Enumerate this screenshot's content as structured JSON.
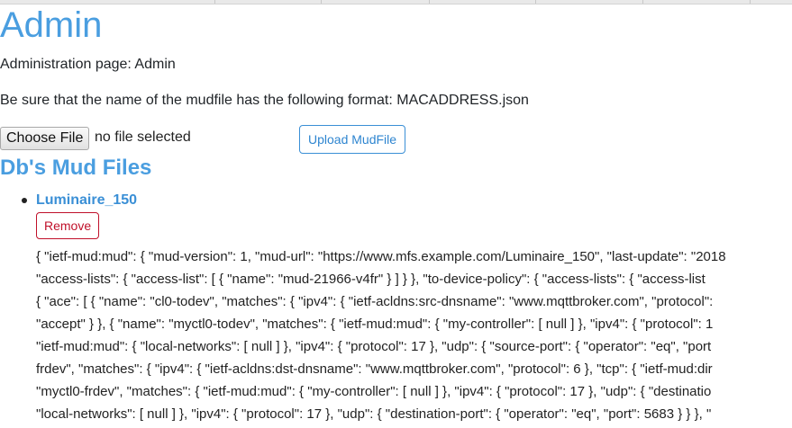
{
  "page": {
    "title": "Admin",
    "subtitle": "Administration page: Admin",
    "instructions": "Be sure that the name of the mudfile has the following format: MACADDRESS.json"
  },
  "upload": {
    "choose_label": "Choose File",
    "file_status": "no file selected",
    "upload_label": "Upload MudFile"
  },
  "db": {
    "section_title": "Db's Mud Files",
    "files": [
      {
        "name": "Luminaire_150",
        "remove_label": "Remove",
        "content_lines": [
          "{ \"ietf-mud:mud\": { \"mud-version\": 1, \"mud-url\": \"https://www.mfs.example.com/Luminaire_150\", \"last-update\": \"2018",
          "\"access-lists\": { \"access-list\": [ { \"name\": \"mud-21966-v4fr\" } ] } }, \"to-device-policy\": { \"access-lists\": { \"access-list",
          "{ \"ace\": [ { \"name\": \"cl0-todev\", \"matches\": { \"ipv4\": { \"ietf-acldns:src-dnsname\": \"www.mqttbroker.com\", \"protocol\":",
          "\"accept\" } }, { \"name\": \"myctl0-todev\", \"matches\": { \"ietf-mud:mud\": { \"my-controller\": [ null ] }, \"ipv4\": { \"protocol\": 1",
          "\"ietf-mud:mud\": { \"local-networks\": [ null ] }, \"ipv4\": { \"protocol\": 17 }, \"udp\": { \"source-port\": { \"operator\": \"eq\", \"port",
          "frdev\", \"matches\": { \"ipv4\": { \"ietf-acldns:dst-dnsname\": \"www.mqttbroker.com\", \"protocol\": 6 }, \"tcp\": { \"ietf-mud:dir",
          "\"myctl0-frdev\", \"matches\": { \"ietf-mud:mud\": { \"my-controller\": [ null ] }, \"ipv4\": { \"protocol\": 17 }, \"udp\": { \"destinatio",
          "\"local-networks\": [ null ] }, \"ipv4\": { \"protocol\": 17 }, \"udp\": { \"destination-port\": { \"operator\": \"eq\", \"port\": 5683 } } }, \""
        ]
      }
    ]
  }
}
